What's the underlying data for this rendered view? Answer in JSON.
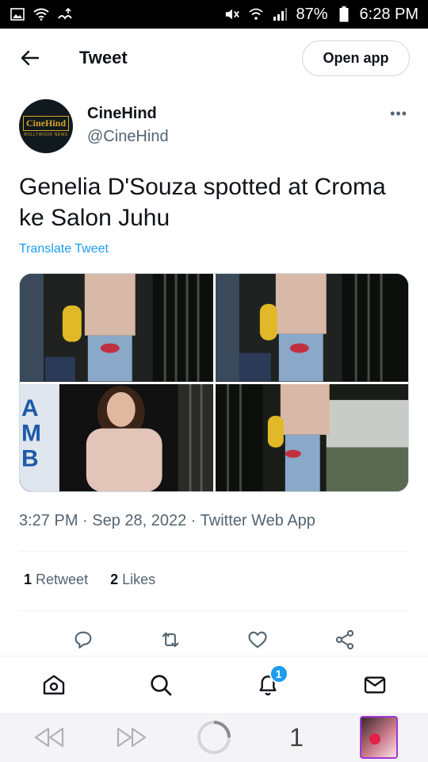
{
  "status_bar": {
    "battery": "87%",
    "time": "6:28 PM"
  },
  "header": {
    "title": "Tweet",
    "open_app_label": "Open app"
  },
  "tweet": {
    "author_name": "CineHind",
    "author_handle": "@CineHind",
    "avatar_logo_text": "CineHind",
    "avatar_logo_subtext": "BOLLYWOOD NEWS",
    "text": "Genelia D'Souza spotted at Croma ke Salon Juhu",
    "translate_label": "Translate Tweet",
    "more_label": "•••",
    "timestamp": "3:27 PM · Sep 28, 2022 · Twitter Web App",
    "retweet_count": "1",
    "retweet_label": "Retweet",
    "like_count": "2",
    "like_label": "Likes"
  },
  "bottom_nav": {
    "notifications_badge": "1"
  },
  "browser": {
    "tab_count": "1"
  },
  "colors": {
    "accent": "#1d9bf0",
    "text_primary": "#0f1419",
    "text_secondary": "#536471",
    "border": "#cfd9de"
  },
  "icons": {
    "back": "arrow-left-icon",
    "more": "more-horizontal-icon",
    "reply": "reply-icon",
    "retweet": "retweet-icon",
    "like": "heart-icon",
    "share": "share-icon",
    "home": "home-icon",
    "search": "search-icon",
    "notifications": "bell-icon",
    "messages": "mail-icon"
  }
}
